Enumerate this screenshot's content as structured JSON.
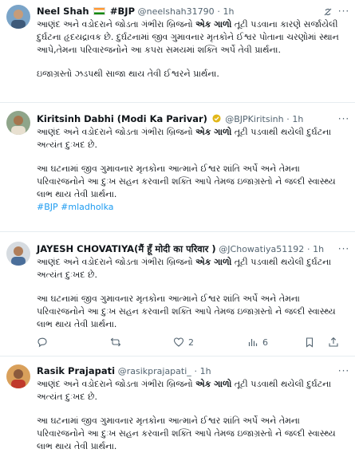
{
  "tweets": [
    {
      "name": "Neel Shah",
      "hashtag": "#BJP",
      "handle": "@neelshah31790",
      "time": "1h",
      "line1a": "આણંદ અને વડોદરાને જોડતા ગંભીરા બ્રિજનો ",
      "line1b": "એક ગાળો",
      "line1c": " તૂટી પડવાના કારણે સર્જાયેલી દુર્ઘટના હૃદયદ્રાવક છે. દુર્ઘટનામાં જીવ ગુમાવનાર મૃતકોને ઈશ્વર પોતાના ચરણોમાં સ્થાન આપે,તેમના પરિવારજનોને આ કપરા સમયમાં શક્તિ અર્પે તેવી પ્રાર્થના.",
      "para2": "ઇજાગ્રસ્તો ઝડપથી સાજા થાય તેવી ઈશ્વરને પ્રાર્થના."
    },
    {
      "name": "Kiritsinh Dabhi (Modi Ka Parivar)",
      "handle": "@BJPKiritsinh",
      "time": "1h",
      "line1a": "આણંદ અને વડોદરાને જોડતા ગંભીરા બ્રિજનો ",
      "line1b": "એક ગાળો",
      "line1c": " તૂટી પડવાથી થયેલી દુર્ઘટના અત્યંત દુઃખદ છે.",
      "para2": "આ ઘટનામાં જીવ ગુમાવનાર મૃતકોના આત્માને ઈશ્વર શાંતિ અર્પે અને તેમના પરિવારજનોને આ દુઃખ સહન કરવાની શક્તિ આપે તેમજ ઇજાગ્રસ્તો ને જલ્દી સ્વાસ્થ્ય લાભ થાય તેવી પ્રાર્થના.",
      "hashtags": "#BJP #mladholka"
    },
    {
      "name": "JAYESH CHOVATIYA(मैं हूँ मोदी का परिवार )",
      "handle": "@JChowatiya51192",
      "time": "1h",
      "line1a": "આણંદ અને વડોદરાને જોડતા ગંભીરા બ્રિજનો ",
      "line1b": "એક ગાળો",
      "line1c": " તૂટી પડવાથી થયેલી દુર્ઘટના અત્યંત દુઃખદ છે.",
      "para2": "આ ઘટનામાં જીવ ગુમાવનાર મૃતકોના આત્માને ઈશ્વર શાંતિ અર્પે અને તેમના પરિવારજનોને આ દુઃખ સહન કરવાની શક્તિ આપે તેમજ ઇજાગ્રસ્તો ને જલ્દી સ્વાસ્થ્ય લાભ થાય તેવી પ્રાર્થના.",
      "likes": "2",
      "views": "6"
    },
    {
      "name": "Rasik Prajapati",
      "handle": "@rasikprajapati_",
      "time": "1h",
      "line1a": "આણંદ અને વડોદરાને જોડતા ગંભીરા બ્રિજનો ",
      "line1b": "એક ગાળો",
      "line1c": " તૂટી પડવાથી થયેલી દુર્ઘટના અત્યંત દુઃખદ છે.",
      "para2": "આ ઘટનામાં જીવ ગુમાવનાર મૃતકોના આત્માને ઈશ્વર શાંતિ અર્પે અને તેમના પરિવારજનોને આ દુઃખ સહન કરવાની શક્તિ આપે તેમજ ઇજાગ્રસ્તો ને જલ્દી સ્વાસ્થ્ય લાભ થાય તેવી પ્રાર્થના."
    }
  ],
  "sep": "·",
  "colors": {
    "link": "#1d9bf0",
    "muted": "#536471",
    "verified_gold": "#e2b719",
    "verified_blue": "#1d9bf0"
  },
  "icons": [
    "verified-badge-icon",
    "flag-india-icon",
    "more-options-icon",
    "reply-icon",
    "retweet-icon",
    "like-icon",
    "views-icon"
  ]
}
